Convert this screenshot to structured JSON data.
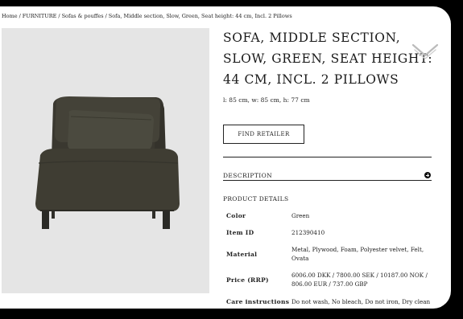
{
  "breadcrumb": {
    "items": [
      "Home",
      "FURNITURE",
      "Sofas & pouffes",
      "Sofa, Middle section, Slow, Green, Seat height: 44 cm, Incl. 2 Pillows"
    ],
    "separator": "/"
  },
  "product": {
    "title": "SOFA, MIDDLE SECTION, SLOW, GREEN, SEAT HEIGHT: 44 CM, INCL. 2 PILLOWS",
    "dimensions": "l: 85 cm, w: 85 cm, h: 77 cm",
    "image_colors": {
      "sofa": "#3f3d33",
      "background": "#e5e5e5"
    }
  },
  "actions": {
    "find_retailer": "FIND RETAILER"
  },
  "description": {
    "label": "DESCRIPTION",
    "icon": "plus-circle-icon"
  },
  "details": {
    "heading": "PRODUCT DETAILS",
    "rows": [
      {
        "label": "Color",
        "value": "Green"
      },
      {
        "label": "Item ID",
        "value": "212390410"
      },
      {
        "label": "Material",
        "value": "Metal, Plywood, Foam, Polyester velvet, Felt, Ovata"
      },
      {
        "label": "Price (RRP)",
        "value": "6006.00 DKK / 7800.00 SEK / 10187.00 NOK / 806.00 EUR / 737.00 GBP"
      },
      {
        "label": "Care instructions",
        "value": "Do not wash, No bleach, Do not iron, Dry clean"
      }
    ]
  },
  "icons": {
    "scroll": "chevron-down-icon"
  }
}
